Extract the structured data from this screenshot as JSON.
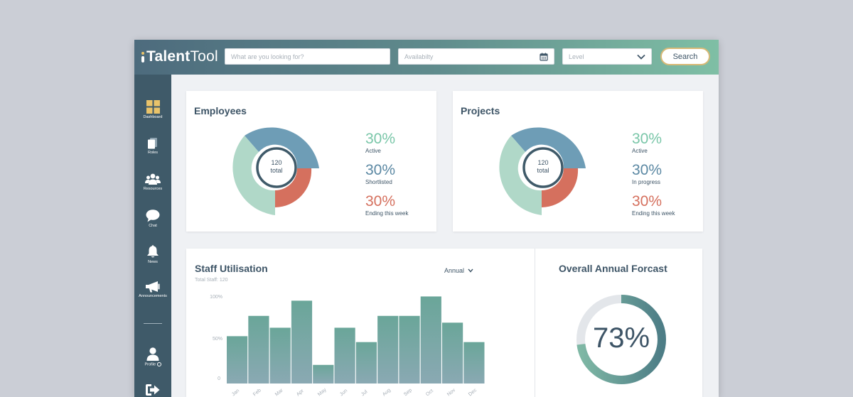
{
  "header": {
    "logo_bold": "Talent",
    "logo_light": "Tool",
    "search_placeholder": "What are you looking for?",
    "availability_placeholder": "Availabilty",
    "level_placeholder": "Level",
    "search_button": "Search"
  },
  "sidebar": {
    "items": [
      {
        "label": "Dashboard",
        "icon": "dashboard-icon"
      },
      {
        "label": "Roles",
        "icon": "roles-icon"
      },
      {
        "label": "Resources",
        "icon": "resources-icon"
      },
      {
        "label": "Chat",
        "icon": "chat-icon"
      },
      {
        "label": "News",
        "icon": "bell-icon"
      },
      {
        "label": "Announcements",
        "icon": "megaphone-icon"
      },
      {
        "label": "Profile",
        "icon": "profile-icon"
      },
      {
        "label": "",
        "icon": "logout-icon"
      }
    ]
  },
  "employees": {
    "title": "Employees",
    "center_value": "120",
    "center_label": "total",
    "stats": [
      {
        "value": "30%",
        "label": "Active"
      },
      {
        "value": "30%",
        "label": "Shortlisted"
      },
      {
        "value": "30%",
        "label": "Ending this week"
      }
    ]
  },
  "projects": {
    "title": "Projects",
    "center_value": "120",
    "center_label": "total",
    "stats": [
      {
        "value": "30%",
        "label": "Active"
      },
      {
        "value": "30%",
        "label": "In progress"
      },
      {
        "value": "30%",
        "label": "Ending this week"
      }
    ]
  },
  "utilisation": {
    "title": "Staff Utilisation",
    "subtitle": "Total Staff: 120",
    "period": "Annual"
  },
  "forecast": {
    "title": "Overall Annual Forcast",
    "value": "73%",
    "fraction": 0.73
  },
  "colors": {
    "green": "#79c6a8",
    "blue": "#5b88a3",
    "red": "#d5705e",
    "accent": "#e9c36a"
  },
  "chart_data": {
    "type": "bar",
    "categories": [
      "Jan",
      "Feb",
      "Mar",
      "Apr",
      "May",
      "Jun",
      "Jul",
      "Aug",
      "Sep",
      "Oct",
      "Nov",
      "Dec"
    ],
    "values": [
      56,
      80,
      66,
      98,
      22,
      66,
      49,
      80,
      80,
      103,
      72,
      49
    ],
    "ylim": [
      0,
      100
    ],
    "yticks": [
      "100%",
      "50%",
      "0"
    ]
  }
}
